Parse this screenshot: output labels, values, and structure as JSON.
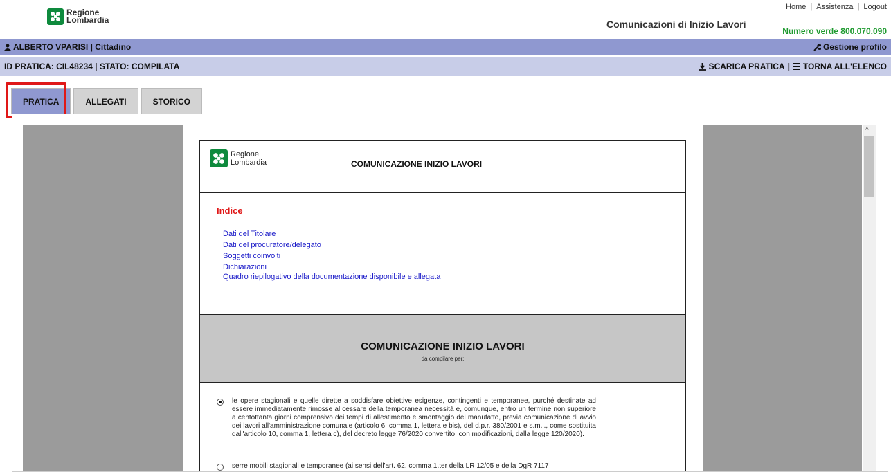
{
  "header": {
    "logo_line1": "Regione",
    "logo_line2": "Lombardia",
    "links": [
      "Home",
      "Assistenza",
      "Logout"
    ],
    "app_title": "Comunicazioni di Inizio Lavori",
    "numero_verde": "Numero verde 800.070.090"
  },
  "userbar": {
    "user": "ALBERTO VPARISI | Cittadino",
    "profile": "Gestione profilo"
  },
  "idbar": {
    "pratica_info": "ID PRATICA: CIL48234 |  STATO: COMPILATA",
    "download": "SCARICA PRATICA",
    "back": "TORNA ALL'ELENCO"
  },
  "tabs": [
    {
      "label": "PRATICA",
      "active": true
    },
    {
      "label": "ALLEGATI",
      "active": false
    },
    {
      "label": "STORICO",
      "active": false
    }
  ],
  "document": {
    "logo_line1": "Regione",
    "logo_line2": "Lombardia",
    "title": "COMUNICAZIONE INIZIO LAVORI",
    "index_title": "Indice",
    "index_links": [
      "Dati del Titolare",
      "Dati del procuratore/delegato",
      "Soggetti coinvolti",
      "Dichiarazioni",
      "Quadro riepilogativo della documentazione disponibile e allegata"
    ],
    "banner_title": "COMUNICAZIONE INIZIO LAVORI",
    "banner_sub": "da compilare per:",
    "options": [
      {
        "selected": true,
        "text": "le opere stagionali e quelle dirette a soddisfare obiettive esigenze, contingenti e temporanee, purché destinate ad essere immediatamente rimosse al cessare della temporanea necessità e, comunque, entro un termine non superiore a centottanta giorni comprensivo dei tempi di allestimento e smontaggio del manufatto, previa comunicazione di avvio dei lavori all'amministrazione comunale (articolo 6, comma 1, lettera e bis), del d.p.r. 380/2001 e s.m.i., come sostituita dall'articolo 10, comma 1, lettera c), del decreto legge 76/2020 convertito, con modificazioni, dalla legge 120/2020)."
      },
      {
        "selected": false,
        "text": "serre mobili stagionali e temporanee (ai sensi dell'art. 62, comma 1.ter della LR 12/05 e della DgR 7117"
      }
    ]
  },
  "colors": {
    "userbar": "#8f98d0",
    "idbar": "#c8cde8",
    "link": "#1919c8",
    "index_title": "#e01818",
    "highlight": "#e01818",
    "numero_verde": "#1e9a2f",
    "brand_green": "#0e8a3d"
  },
  "icons": [
    "logo-icon",
    "user-icon",
    "wrench-icon",
    "download-icon",
    "list-icon"
  ]
}
